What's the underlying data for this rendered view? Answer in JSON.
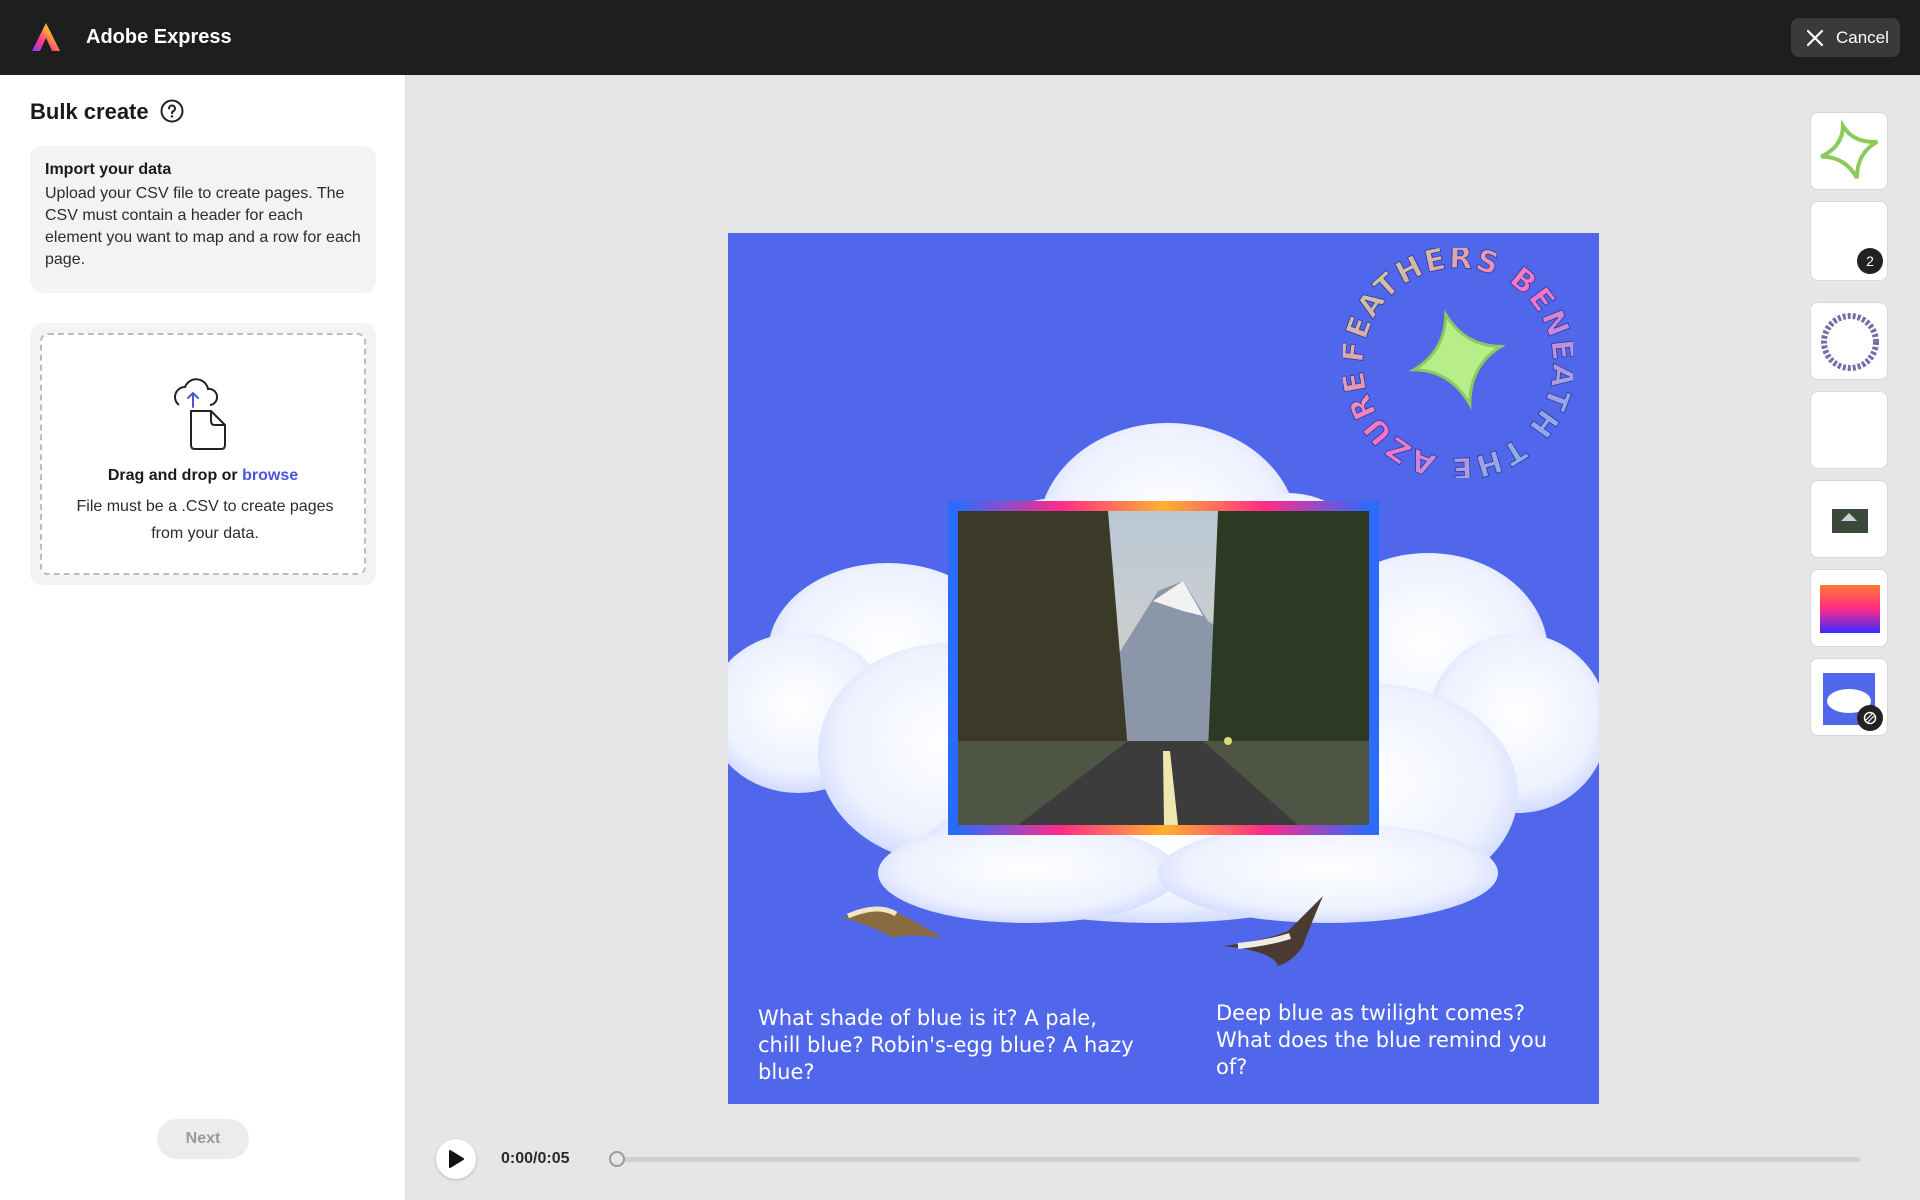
{
  "app": {
    "title": "Adobe Express"
  },
  "header": {
    "cancel_label": "Cancel"
  },
  "panel": {
    "title": "Bulk create",
    "info": {
      "title": "Import your data",
      "text": "Upload your CSV file to create pages. The CSV must contain a header for each element you want to map and a row for each page."
    },
    "dropzone": {
      "prefix": "Drag and drop or ",
      "link": "browse",
      "note": "File must be a .CSV to create pages from your data."
    },
    "next_label": "Next"
  },
  "canvas": {
    "circular_text": "FEATHERS BENEATH THE AZURE",
    "caption_left": "What shade of blue is it? A pale, chill blue? Robin's-egg blue? A hazy blue?",
    "caption_right": "Deep blue as twilight comes? What does the blue remind you of?",
    "background_color": "#5067ec"
  },
  "layers": {
    "badge_count": "2",
    "items": [
      "star-shape",
      "group",
      "circular-text",
      "blank",
      "landscape-photo",
      "gradient-frame",
      "clouds-background"
    ]
  },
  "playback": {
    "time": "0:00/0:05",
    "progress": 0.0
  },
  "colors": {
    "accent": "#4a56d6",
    "topbar": "#1e1e1e",
    "star": "#b7ee8a"
  }
}
